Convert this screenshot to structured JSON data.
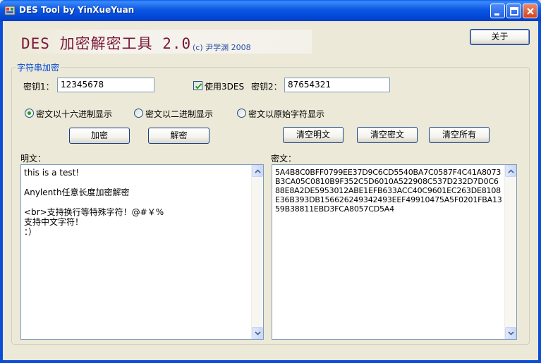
{
  "window": {
    "title": "DES Tool by YinXueYuan"
  },
  "header": {
    "logo_main": "DES 加密解密工具 2.0",
    "logo_sub": "(c) 尹学渊 2008",
    "about_button": "关于"
  },
  "group": {
    "title": "字符串加密"
  },
  "keys": {
    "key1_label": "密钥1：",
    "key1_value": "12345678",
    "use3des_label": "使用3DES",
    "use3des_checked": true,
    "key2_label": "密钥2：",
    "key2_value": "87654321"
  },
  "display_mode": {
    "options": [
      "密文以十六进制显示",
      "密文以二进制显示",
      "密文以原始字符显示"
    ],
    "selected": 0
  },
  "buttons": {
    "encrypt": "加密",
    "decrypt": "解密",
    "clear_plain": "清空明文",
    "clear_cipher": "清空密文",
    "clear_all": "清空所有"
  },
  "plaintext": {
    "label": "明文：",
    "value": "this is a test!\n\nAnylenth任意长度加密解密\n\n<br>支持换行等特殊字符！@#￥%\n支持中文字符！\n：）"
  },
  "ciphertext": {
    "label": "密文：",
    "value": "5A4B8C0BFF0799EE37D9C6CD5540BA7C0587F4C41A8073B3CA05C0810B9F352C5D6010A522908C537D232D7D0C688E8A2DE5953012ABE1EFB633ACC40C9601EC263DE8108E36B393DB156626249342493EEF49910475A5F0201FBA1359B38811EBD3FCA8057CD5A4"
  }
}
